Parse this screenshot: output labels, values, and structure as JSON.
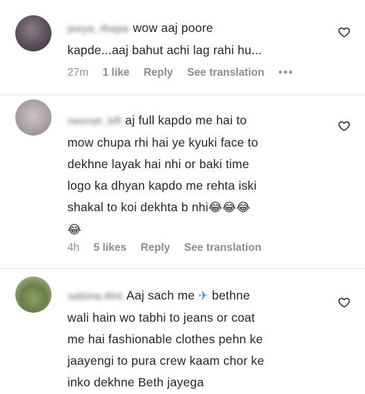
{
  "comments": [
    {
      "username": "jeeya_thapa",
      "text_lines": [
        "wow aaj poore",
        "kapde...aaj bahut achi lag rahi hu..."
      ],
      "time": "27m",
      "likes": "1 like",
      "reply": "Reply",
      "see_translation": "See translation",
      "more": "•••"
    },
    {
      "username": "neenat_kff",
      "text_lines": [
        "aj full kapdo me hai to",
        "mow chupa rhi hai ye kyuki face to",
        "dekhne layak hai nhi or baki time",
        "logo ka dhyan kapdo me rehta iski",
        "shakal to koi dekhta b nhi"
      ],
      "emoji_line": "😂",
      "emoji_tail": "😂😂😂",
      "time": "4h",
      "likes": "5 likes",
      "reply": "Reply",
      "see_translation": "See translation"
    },
    {
      "username": "sabina.904",
      "text_lines": [
        "Aaj sach me",
        "bethne",
        "wali hain wo tabhi to jeans or coat",
        "me hai fashionable clothes pehn ke",
        "jaayengi to pura crew kaam chor ke",
        "inko dekhne Beth jayega"
      ],
      "plane_emoji": "✈"
    }
  ],
  "icons": {
    "like": "heart-outline-icon",
    "more": "more-options-icon"
  }
}
